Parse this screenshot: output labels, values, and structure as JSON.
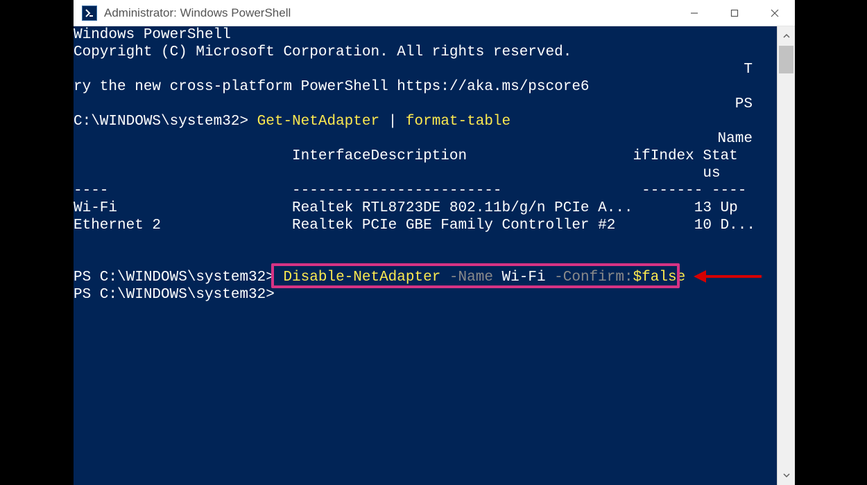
{
  "window": {
    "title": "Administrator: Windows PowerShell"
  },
  "terminal": {
    "header1": "Windows PowerShell",
    "header2": "Copyright (C) Microsoft Corporation. All rights reserved.",
    "cutoff_right1": "T",
    "try_line": "ry the new cross-platform PowerShell https://aka.ms/pscore6",
    "cutoff_right2": "PS",
    "prompt1_prefix": "C:\\WINDOWS\\system32> ",
    "cmd1_part1": "Get-NetAdapter",
    "cmd1_pipe": " | ",
    "cmd1_part2": "format-table",
    "cutoff_right3": "Name",
    "table_header": "                         InterfaceDescription                   ifIndex Stat",
    "table_header2": "                                                                        us",
    "table_divider": "----                     ------------------------                ------- ----",
    "row1": "Wi-Fi                    Realtek RTL8723DE 802.11b/g/n PCIe A...       13 Up",
    "row2": "Ethernet 2               Realtek PCIe GBE Family Controller #2         10 D...",
    "prompt2_prefix": "PS C:\\WINDOWS\\system32> ",
    "cmd2_cmdlet": "Disable-NetAdapter",
    "cmd2_space1": " ",
    "cmd2_param1": "-Name",
    "cmd2_space2": " ",
    "cmd2_val1": "Wi-Fi",
    "cmd2_space3": " ",
    "cmd2_param2": "-Confirm:",
    "cmd2_val2": "$false",
    "prompt3": "PS C:\\WINDOWS\\system32>"
  },
  "colors": {
    "ps_bg": "#012456",
    "cmd_yellow": "#fce94f",
    "param_gray": "#8a8a8a",
    "highlight": "#d63384",
    "arrow": "#d40000"
  }
}
